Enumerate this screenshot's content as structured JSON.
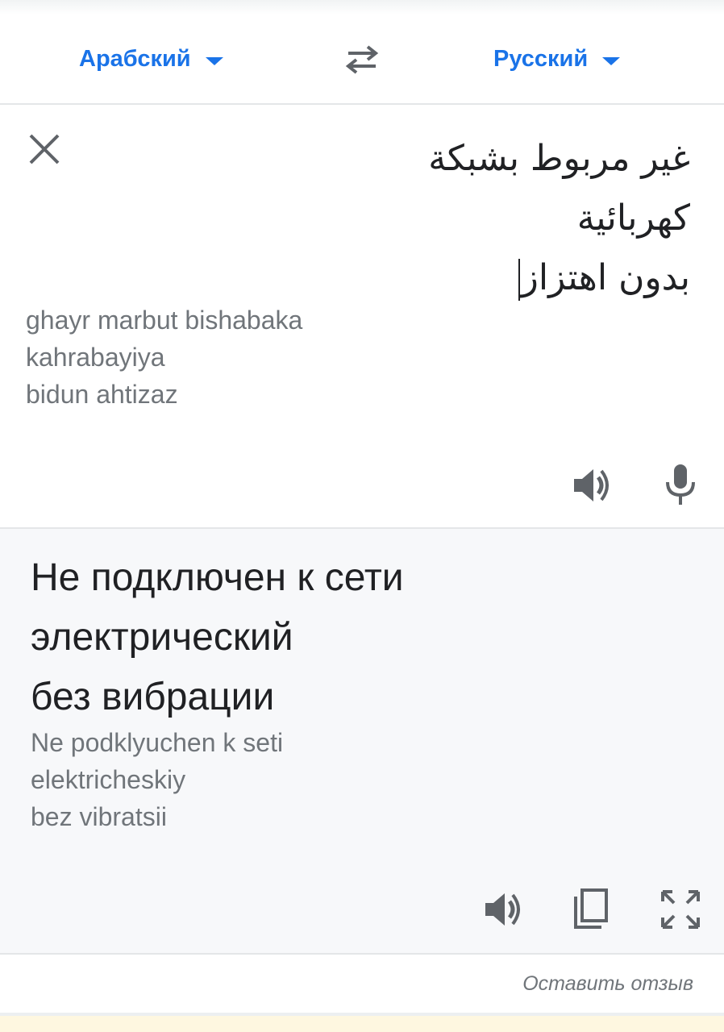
{
  "language_bar": {
    "source_language": "Арабский",
    "target_language": "Русский",
    "swap_icon": "swap-arrows-icon",
    "accent_color": "#1a73e8"
  },
  "source": {
    "lines": [
      "غير مربوط بشبكة",
      "كهربائية",
      "بدون اهتزاز"
    ],
    "transliteration": [
      "ghayr marbut bishabaka",
      "kahrabayiya",
      "bidun ahtizaz"
    ],
    "icons": [
      "close-icon",
      "speaker-icon",
      "microphone-icon"
    ]
  },
  "translation": {
    "lines": [
      "Не подключен к сети",
      "электрический",
      "без вибрации"
    ],
    "transliteration": [
      "Ne podklyuchen k seti",
      "elektricheskiy",
      "bez vibratsii"
    ],
    "icons": [
      "speaker-icon",
      "copy-icon",
      "fullscreen-icon"
    ]
  },
  "footer": {
    "feedback_link": "Оставить отзыв"
  }
}
